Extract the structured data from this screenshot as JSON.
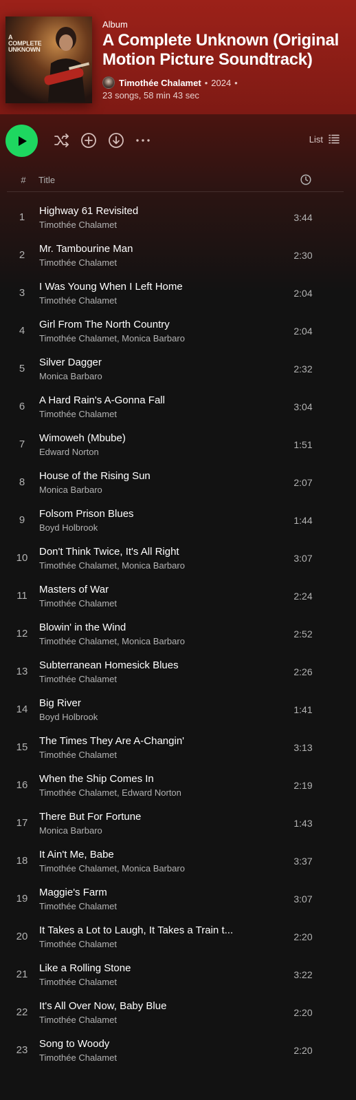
{
  "album": {
    "type_label": "Album",
    "title": "A Complete Unknown (Original Motion Picture Soundtrack)",
    "cover_text": "A\nCOMPLETE\nUNKNOWN",
    "artist": "Timothée Chalamet",
    "year": "2024",
    "stats": "23 songs, 58 min 43 sec",
    "accent_color": "#9c2119"
  },
  "controls": {
    "play_icon": "play-icon",
    "shuffle_icon": "shuffle-icon",
    "add_icon": "add-circle-icon",
    "download_icon": "download-circle-icon",
    "more_icon": "more-horizontal-icon",
    "view_label": "List",
    "view_icon": "list-icon",
    "play_color": "#1ed760"
  },
  "table": {
    "num_header": "#",
    "title_header": "Title",
    "duration_icon": "clock-icon"
  },
  "tracks": [
    {
      "num": "1",
      "title": "Highway 61 Revisited",
      "artist": "Timothée Chalamet",
      "duration": "3:44"
    },
    {
      "num": "2",
      "title": "Mr. Tambourine Man",
      "artist": "Timothée Chalamet",
      "duration": "2:30"
    },
    {
      "num": "3",
      "title": "I Was Young When I Left Home",
      "artist": "Timothée Chalamet",
      "duration": "2:04"
    },
    {
      "num": "4",
      "title": "Girl From The North Country",
      "artist": "Timothée Chalamet, Monica Barbaro",
      "duration": "2:04"
    },
    {
      "num": "5",
      "title": "Silver Dagger",
      "artist": "Monica Barbaro",
      "duration": "2:32"
    },
    {
      "num": "6",
      "title": "A Hard Rain's A-Gonna Fall",
      "artist": "Timothée Chalamet",
      "duration": "3:04"
    },
    {
      "num": "7",
      "title": "Wimoweh (Mbube)",
      "artist": "Edward Norton",
      "duration": "1:51"
    },
    {
      "num": "8",
      "title": "House of the Rising Sun",
      "artist": "Monica Barbaro",
      "duration": "2:07"
    },
    {
      "num": "9",
      "title": "Folsom Prison Blues",
      "artist": "Boyd Holbrook",
      "duration": "1:44"
    },
    {
      "num": "10",
      "title": "Don't Think Twice, It's All Right",
      "artist": "Timothée Chalamet, Monica Barbaro",
      "duration": "3:07"
    },
    {
      "num": "11",
      "title": "Masters of War",
      "artist": "Timothée Chalamet",
      "duration": "2:24"
    },
    {
      "num": "12",
      "title": "Blowin' in the Wind",
      "artist": "Timothée Chalamet, Monica Barbaro",
      "duration": "2:52"
    },
    {
      "num": "13",
      "title": "Subterranean Homesick Blues",
      "artist": "Timothée Chalamet",
      "duration": "2:26"
    },
    {
      "num": "14",
      "title": "Big River",
      "artist": "Boyd Holbrook",
      "duration": "1:41"
    },
    {
      "num": "15",
      "title": "The Times They Are A-Changin'",
      "artist": "Timothée Chalamet",
      "duration": "3:13"
    },
    {
      "num": "16",
      "title": "When the Ship Comes In",
      "artist": "Timothée Chalamet, Edward Norton",
      "duration": "2:19"
    },
    {
      "num": "17",
      "title": "There But For Fortune",
      "artist": "Monica Barbaro",
      "duration": "1:43"
    },
    {
      "num": "18",
      "title": "It Ain't Me, Babe",
      "artist": "Timothée Chalamet, Monica Barbaro",
      "duration": "3:37"
    },
    {
      "num": "19",
      "title": "Maggie's Farm",
      "artist": "Timothée Chalamet",
      "duration": "3:07"
    },
    {
      "num": "20",
      "title": "It Takes a Lot to Laugh, It Takes a Train t...",
      "artist": "Timothée Chalamet",
      "duration": "2:20"
    },
    {
      "num": "21",
      "title": "Like a Rolling Stone",
      "artist": "Timothée Chalamet",
      "duration": "3:22"
    },
    {
      "num": "22",
      "title": "It's All Over Now, Baby Blue",
      "artist": "Timothée Chalamet",
      "duration": "2:20"
    },
    {
      "num": "23",
      "title": "Song to Woody",
      "artist": "Timothée Chalamet",
      "duration": "2:20"
    }
  ]
}
